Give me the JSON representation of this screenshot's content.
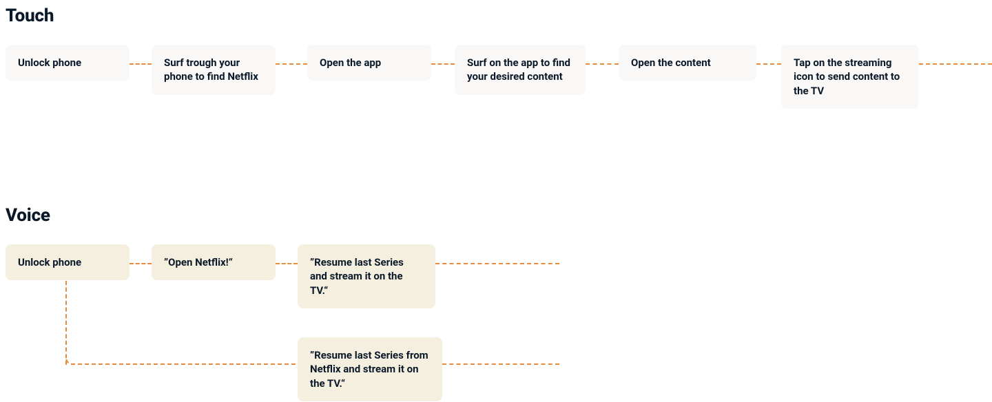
{
  "sections": {
    "touch": {
      "title": "Touch",
      "steps": [
        "Unlock phone",
        "Surf trough your phone to find Netflix",
        "Open the app",
        "Surf on the app to find your desired content",
        "Open the content",
        "Tap on the streaming icon to send content to the TV"
      ]
    },
    "voice": {
      "title": "Voice",
      "steps": [
        "Unlock phone",
        "”Open Netflix!“",
        "”Resume last Series and stream it on the TV.“"
      ],
      "alt": "”Resume last Series from Netflix and stream it on the TV.“"
    }
  },
  "colors": {
    "connector": "#e58a3a",
    "card_pale": "#faf8f6",
    "card_cream": "#f5efdf",
    "text": "#0a1929"
  }
}
